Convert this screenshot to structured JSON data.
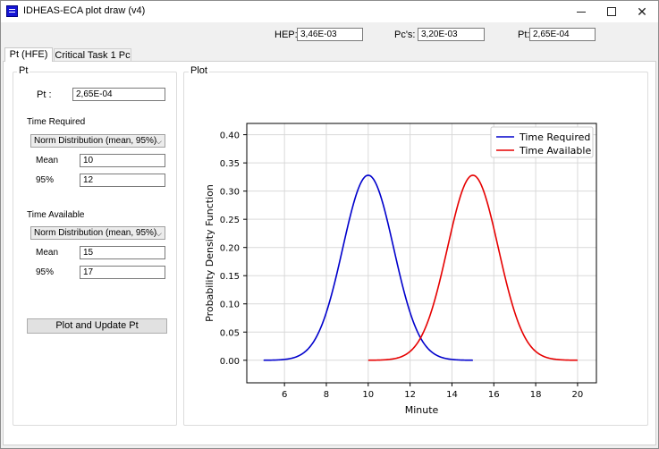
{
  "window": {
    "title": "IDHEAS-ECA plot draw (v4)"
  },
  "summary": {
    "hep_label": "HEP:",
    "hep_value": "3,46E-03",
    "pcs_label": "Pc's:",
    "pcs_value": "3,20E-03",
    "pt_label": "Pt:",
    "pt_value": "2,65E-04"
  },
  "tabs": [
    {
      "label": "Pt (HFE)"
    },
    {
      "label": "Critical Task 1 Pc"
    }
  ],
  "pt_group": {
    "title": "Pt",
    "pt_label": "Pt :",
    "pt_value": "2,65E-04",
    "time_required": {
      "title": "Time Required",
      "distribution": "Norm Distribution (mean, 95%)",
      "mean_label": "Mean",
      "mean_value": "10",
      "p95_label": "95%",
      "p95_value": "12"
    },
    "time_available": {
      "title": "Time Available",
      "distribution": "Norm Distribution (mean, 95%)",
      "mean_label": "Mean",
      "mean_value": "15",
      "p95_label": "95%",
      "p95_value": "17"
    },
    "plot_button": "Plot and Update Pt"
  },
  "plot_group": {
    "title": "Plot"
  },
  "chart_data": {
    "type": "line",
    "xlabel": "Minute",
    "ylabel": "Probability Density Function",
    "xlim": [
      4.2,
      20.9
    ],
    "ylim": [
      -0.04,
      0.42
    ],
    "xticks": [
      6,
      8,
      10,
      12,
      14,
      16,
      18,
      20
    ],
    "yticks": [
      0.0,
      0.05,
      0.1,
      0.15,
      0.2,
      0.25,
      0.3,
      0.35,
      0.4
    ],
    "grid": true,
    "legend": "top-right",
    "series": [
      {
        "name": "Time Required",
        "color": "#0000cc",
        "mean": 10,
        "p95": 12,
        "x_range": [
          5,
          15
        ]
      },
      {
        "name": "Time Available",
        "color": "#e60000",
        "mean": 15,
        "p95": 17,
        "x_range": [
          10,
          20
        ]
      }
    ]
  }
}
